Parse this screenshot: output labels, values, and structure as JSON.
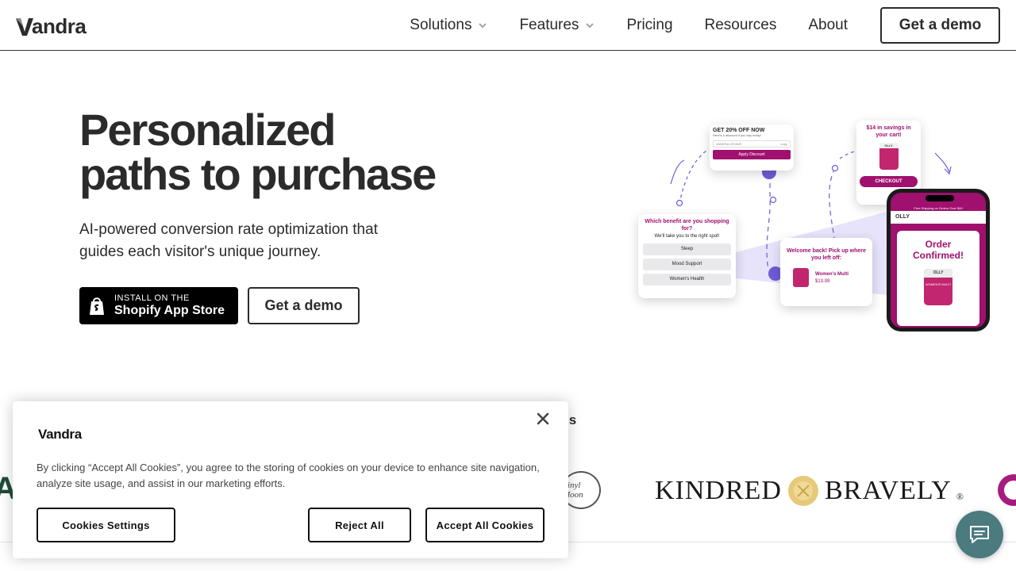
{
  "header": {
    "logo_text": "Vandra",
    "nav": [
      {
        "label": "Solutions",
        "has_dropdown": true
      },
      {
        "label": "Features",
        "has_dropdown": true
      },
      {
        "label": "Pricing",
        "has_dropdown": false
      },
      {
        "label": "Resources",
        "has_dropdown": false
      },
      {
        "label": "About",
        "has_dropdown": false
      }
    ],
    "cta": "Get a demo"
  },
  "hero": {
    "title": "Personalized paths to purchase",
    "subtitle": "AI-powered conversion rate optimization that guides each visitor's unique journey.",
    "shopify_small": "INSTALL ON THE",
    "shopify_big": "Shopify App Store",
    "demo_label": "Get a demo"
  },
  "illustration": {
    "popup_discount_title": "GET 20% OFF NOW",
    "popup_discount_sub": "Here's a discount if you buy today!",
    "popup_discount_code": "VANDRA-20SAVE",
    "popup_discount_code_copy": "copy",
    "popup_discount_btn": "Apply Discount",
    "popup_savings_title": "$14 in savings in your cart!",
    "popup_savings_brand": "OLLY",
    "popup_savings_btn": "CHECKOUT",
    "popup_quiz_title": "Which benefit are you shopping for?",
    "popup_quiz_sub": "We'll take you to the right spot!",
    "popup_quiz_options": [
      "Sleep",
      "Mood Support",
      "Women's Health"
    ],
    "popup_welcome_title": "Welcome back! Pick up where you left off:",
    "popup_welcome_product": "Women's Multi",
    "popup_welcome_price": "$13.99",
    "phone_banner": "Free Shipping on Orders Over $40",
    "phone_brand": "OLLY",
    "phone_confirm": "Order Confirmed!",
    "phone_product_brand": "OLLY",
    "phone_product_name": "WOMEN'S MULTI",
    "accent": "#a0106e",
    "flow_color": "#6e5bd6"
  },
  "brands": {
    "label": "nds",
    "kindred": "KINDRED",
    "bravely": "BRAVELY",
    "registered": "®",
    "left_partial": "A",
    "vinyl": "Vinyl Moon"
  },
  "cookie": {
    "logo": "Vandra",
    "text": "By clicking “Accept All Cookies”, you agree to the storing of cookies on your device to enhance site navigation, analyze site usage, and assist in our marketing efforts.",
    "settings": "Cookies Settings",
    "reject": "Reject All",
    "accept": "Accept All Cookies"
  },
  "colors": {
    "text": "#2b2b2b",
    "chat_bg": "#4b7a7f",
    "left_brand": "#1f4d3a",
    "right_brand": "#a61c7d"
  },
  "icons": {
    "chevron": "chevron-down-icon",
    "shopify": "shopify-bag-icon",
    "close": "close-icon",
    "chat": "chat-bubble-icon"
  }
}
